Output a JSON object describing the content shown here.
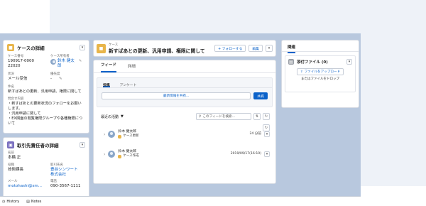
{
  "case_detail": {
    "title": "ケースの詳細",
    "case_number_label": "ケース番号",
    "case_number": "190917-000022020",
    "owner_label": "ケース所有者",
    "owner": "鈴木 健太郎",
    "status_label": "状況",
    "status": "メール受信",
    "priority_label": "優先度",
    "priority": "-",
    "subject_label": "件名",
    "subject": "新すばあとの更新、汎用申請、権限に関して",
    "description_label": "問合せ内容",
    "description": "・新すばあとの更新状況のフォローをお願いします。\n・汎用申請に関して\n・EX図面の閲覧権限グループや各種権限について"
  },
  "contact": {
    "title": "取引先責任者の詳細",
    "name_label": "名前",
    "name": "本橋 正",
    "title_label": "役職",
    "title_value": "技術課長",
    "account_label": "取引先名",
    "account": "豊谷シンワート株式会社",
    "email_label": "メール",
    "email": "motohashi@sm...",
    "phone_label": "電話",
    "phone": "090-3567-1111"
  },
  "header": {
    "object_label": "ケース",
    "title": "新すばあとの更新、汎用申請、権限に関して",
    "follow_button": "+ フォローする",
    "edit_button": "編集"
  },
  "tabs": [
    "フィード",
    "詳細"
  ],
  "publisher": {
    "tabs": [
      "投稿",
      "アンケート"
    ],
    "placeholder": "最新情報を共有...",
    "share_button": "共有"
  },
  "feed": {
    "sort_label": "最近の活動",
    "search_placeholder": "このフィードを検索...",
    "items": [
      {
        "author": "鈴木 健太郎",
        "action": "ケース更新",
        "time": "24 分前"
      },
      {
        "author": "鈴木 健太郎",
        "action": "ケース作成",
        "time": "2019/09/17(16:10)"
      }
    ]
  },
  "related": {
    "title": "関連",
    "files_title": "添付ファイル (0)",
    "upload_button": "ファイルをアップロード",
    "drop_text": "またはファイルをドロップ"
  },
  "bottom": {
    "history": "History",
    "notes": "Notes"
  }
}
